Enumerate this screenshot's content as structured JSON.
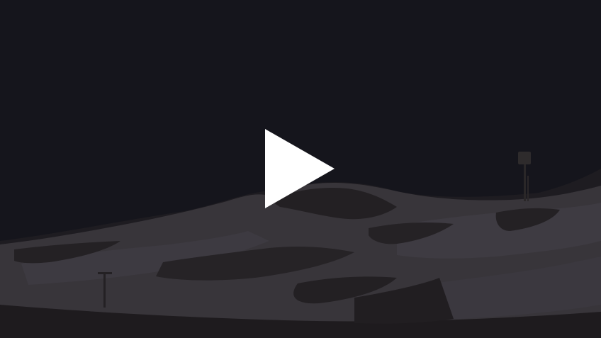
{
  "video_player": {
    "state": "paused",
    "play_button": {
      "icon": "play-icon",
      "color": "#ffffff"
    },
    "frame": {
      "subject": "snow-covered-mountain-at-night",
      "sky_color": "#15151c",
      "snow_color": "#38353a",
      "rock_color": "#221f21"
    }
  }
}
